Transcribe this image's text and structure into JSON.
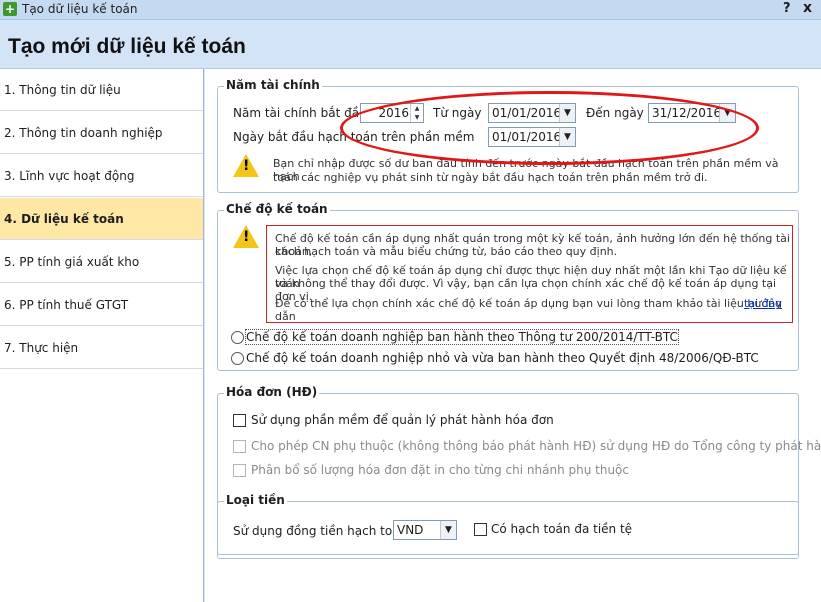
{
  "window": {
    "title": "Tạo dữ liệu kế toán",
    "help": "?",
    "close": "x"
  },
  "page_title": "Tạo mới dữ liệu kế toán",
  "sidebar": {
    "items": [
      {
        "label": "1. Thông tin dữ liệu"
      },
      {
        "label": "2. Thông tin doanh nghiệp"
      },
      {
        "label": "3. Lĩnh vực hoạt động"
      },
      {
        "label": "4. Dữ liệu kế toán"
      },
      {
        "label": "5. PP tính giá xuất kho"
      },
      {
        "label": "6. PP tính thuế GTGT"
      },
      {
        "label": "7. Thực hiện"
      }
    ]
  },
  "fiscal_year": {
    "legend": "Năm tài chính",
    "year_label": "Năm tài chính bắt đầu",
    "year_value": "2016",
    "from_label": "Từ ngày",
    "from_value": "01/01/2016",
    "to_label": "Đến ngày",
    "to_value": "31/12/2016",
    "start_label": "Ngày bắt đầu hạch toán trên phần mềm",
    "start_value": "01/01/2016",
    "note1": "Bạn chỉ nhập được số dư ban đầu tính đến trước ngày bắt đầu hạch toán trên phần mềm và hạch",
    "note2": "toán các nghiệp vụ phát sinh từ ngày bắt đầu hạch toán trên phần mềm trở đi."
  },
  "regime": {
    "legend": "Chế độ kế toán",
    "warn1": "Chế độ kế toán cần áp dụng nhất quán trong một kỳ kế toán, ảnh hưởng lớn đến hệ thống tài khoản,",
    "warn2": "cách hạch toán và mẫu biểu chứng từ, báo cáo theo quy định.",
    "warn3": "Việc lựa chọn chế độ kế toán áp dụng chỉ được thực hiện duy nhất một lần khi Tạo dữ liệu kế toán",
    "warn4": "và không thể thay đổi được. Vì vậy, bạn cần lựa chọn chính xác chế độ kế toán áp dụng tại đơn vị.",
    "warn5": "Để có thể lựa chọn chính xác chế độ kế toán áp dụng bạn vui lòng tham khảo tài liệu hướng dẫn",
    "link": "tại đây",
    "option1": "Chế độ kế toán doanh nghiệp ban hành theo Thông tư 200/2014/TT-BTC",
    "option2": "Chế độ kế toán doanh nghiệp nhỏ và vừa ban hành theo Quyết định 48/2006/QĐ-BTC"
  },
  "invoice": {
    "legend": "Hóa đơn (HĐ)",
    "opt1": "Sử dụng phần mềm để quản lý phát hành hóa đơn",
    "opt2": "Cho phép CN phụ thuộc (không thông báo phát hành HĐ) sử dụng HĐ do Tổng công ty phát hành",
    "opt3": "Phân bổ số lượng hóa đơn đặt in cho từng chi nhánh phụ thuộc"
  },
  "currency": {
    "legend": "Loại tiền",
    "label": "Sử dụng đồng tiền hạch toán",
    "value": "VND",
    "multi": "Có hạch toán đa tiền tệ"
  },
  "colors": {
    "accent": "#ffe7a6",
    "highlight": "#e01818",
    "link": "#0033cc"
  },
  "icons": [
    "plus-icon",
    "warning-icon",
    "chevron-down-icon",
    "spin-arrows-icon"
  ]
}
